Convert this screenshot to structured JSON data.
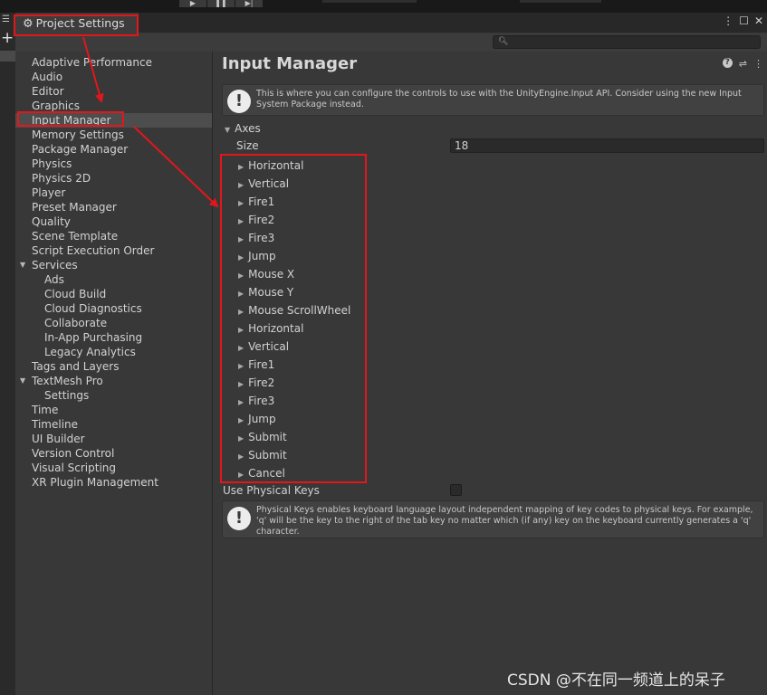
{
  "toolbar": {
    "play_icon": "play-icon",
    "pause_icon": "pause-icon",
    "step_icon": "step-icon"
  },
  "window": {
    "tab_title": "Project Settings",
    "tab_icon": "gear-icon",
    "controls": [
      "kebab-menu-icon",
      "maximize-icon",
      "close-icon"
    ]
  },
  "search": {
    "placeholder": ""
  },
  "sidebar": {
    "items": [
      {
        "label": "Adaptive Performance",
        "indent": 0
      },
      {
        "label": "Audio",
        "indent": 0
      },
      {
        "label": "Editor",
        "indent": 0
      },
      {
        "label": "Graphics",
        "indent": 0
      },
      {
        "label": "Input Manager",
        "indent": 0,
        "selected": true
      },
      {
        "label": "Memory Settings",
        "indent": 0
      },
      {
        "label": "Package Manager",
        "indent": 0
      },
      {
        "label": "Physics",
        "indent": 0
      },
      {
        "label": "Physics 2D",
        "indent": 0
      },
      {
        "label": "Player",
        "indent": 0
      },
      {
        "label": "Preset Manager",
        "indent": 0
      },
      {
        "label": "Quality",
        "indent": 0
      },
      {
        "label": "Scene Template",
        "indent": 0
      },
      {
        "label": "Script Execution Order",
        "indent": 0
      },
      {
        "label": "Services",
        "indent": 0,
        "expanded": true
      },
      {
        "label": "Ads",
        "indent": 1
      },
      {
        "label": "Cloud Build",
        "indent": 1
      },
      {
        "label": "Cloud Diagnostics",
        "indent": 1
      },
      {
        "label": "Collaborate",
        "indent": 1
      },
      {
        "label": "In-App Purchasing",
        "indent": 1
      },
      {
        "label": "Legacy Analytics",
        "indent": 1
      },
      {
        "label": "Tags and Layers",
        "indent": 0
      },
      {
        "label": "TextMesh Pro",
        "indent": 0,
        "expanded": true
      },
      {
        "label": "Settings",
        "indent": 1
      },
      {
        "label": "Time",
        "indent": 0
      },
      {
        "label": "Timeline",
        "indent": 0
      },
      {
        "label": "UI Builder",
        "indent": 0
      },
      {
        "label": "Version Control",
        "indent": 0
      },
      {
        "label": "Visual Scripting",
        "indent": 0
      },
      {
        "label": "XR Plugin Management",
        "indent": 0
      }
    ]
  },
  "main": {
    "title": "Input Manager",
    "header_icons": [
      "help-icon",
      "settings-sliders-icon",
      "kebab-menu-icon"
    ],
    "info_message": "This is where you can configure the controls to use with the UnityEngine.Input API. Consider using the new Input System Package instead.",
    "axes_label": "Axes",
    "size_label": "Size",
    "size_value": "18",
    "axes": [
      "Horizontal",
      "Vertical",
      "Fire1",
      "Fire2",
      "Fire3",
      "Jump",
      "Mouse X",
      "Mouse Y",
      "Mouse ScrollWheel",
      "Horizontal",
      "Vertical",
      "Fire1",
      "Fire2",
      "Fire3",
      "Jump",
      "Submit",
      "Submit",
      "Cancel"
    ],
    "physical_keys_label": "Use Physical Keys",
    "physical_keys_checked": false,
    "physical_keys_help": "Physical Keys enables keyboard language layout independent mapping of key codes to physical keys. For example, 'q' will be the key to the right of the tab key no matter which (if any) key on the keyboard currently generates a 'q' character."
  },
  "annotation": {
    "color": "#e3161b"
  },
  "watermark": "CSDN @不在同一频道上的呆子"
}
